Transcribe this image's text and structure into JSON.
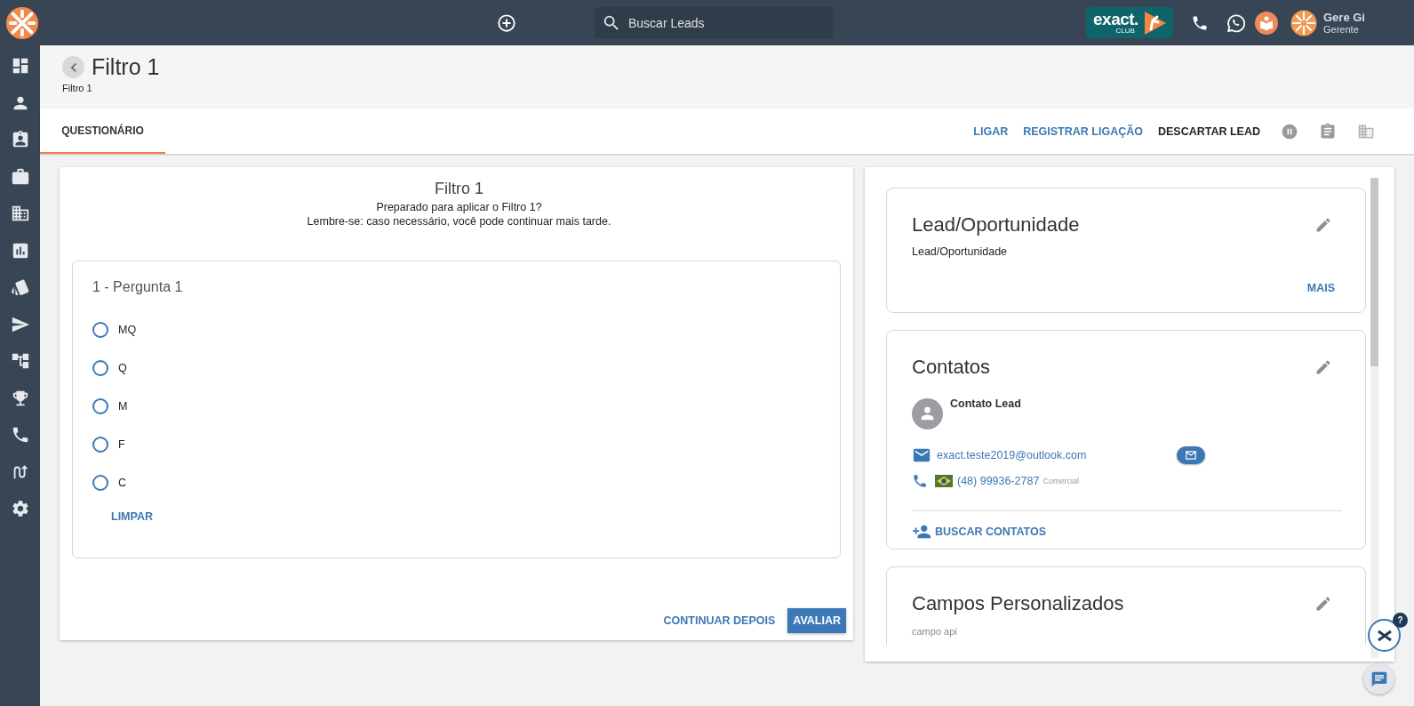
{
  "topbar": {
    "search": {
      "placeholder": "Buscar Leads"
    },
    "club_logo": {
      "word": "exact.",
      "tag": "CLUB"
    },
    "user": {
      "name": "Gere Gi",
      "role": "Gerente"
    }
  },
  "header": {
    "title": "Filtro 1",
    "breadcrumb": "Filtro 1"
  },
  "tabs": [
    {
      "label": "QUESTIONÁRIO",
      "selected": true
    }
  ],
  "actions": [
    {
      "label": "LIGAR",
      "kind": "link"
    },
    {
      "label": "REGISTRAR LIGAÇÃO",
      "kind": "link"
    },
    {
      "label": "DESCARTAR LEAD",
      "kind": "plain"
    }
  ],
  "questionnaire": {
    "title": "Filtro 1",
    "intro": [
      "Preparado para aplicar o Filtro 1?",
      "Lembre-se: caso necessário, você pode continuar mais tarde."
    ],
    "question": {
      "title": "1 - Pergunta 1",
      "options": [
        {
          "label": "MQ",
          "selected": false
        },
        {
          "label": "Q",
          "selected": false
        },
        {
          "label": "M",
          "selected": false
        },
        {
          "label": "F",
          "selected": false
        },
        {
          "label": "C",
          "selected": false
        }
      ],
      "clear": "LIMPAR"
    },
    "buttons": [
      {
        "label": "CONTINUAR DEPOIS",
        "kind": "text"
      },
      {
        "label": "AVALIAR",
        "kind": "primary"
      }
    ]
  },
  "lead_card": {
    "title": "Lead/Oportunidade",
    "value": "Lead/Oportunidade",
    "more": "MAIS"
  },
  "contacts_card": {
    "title": "Contatos",
    "contact": {
      "name": "Contato Lead",
      "email": "exact.teste2019@outlook.com",
      "phone": "(48) 99936-2787",
      "phone_type": "Comercial"
    },
    "search": "BUSCAR CONTATOS"
  },
  "custom_fields_card": {
    "title": "Campos Personalizados",
    "fields": [
      {
        "label": "campo api"
      }
    ]
  },
  "help_badge": "?"
}
